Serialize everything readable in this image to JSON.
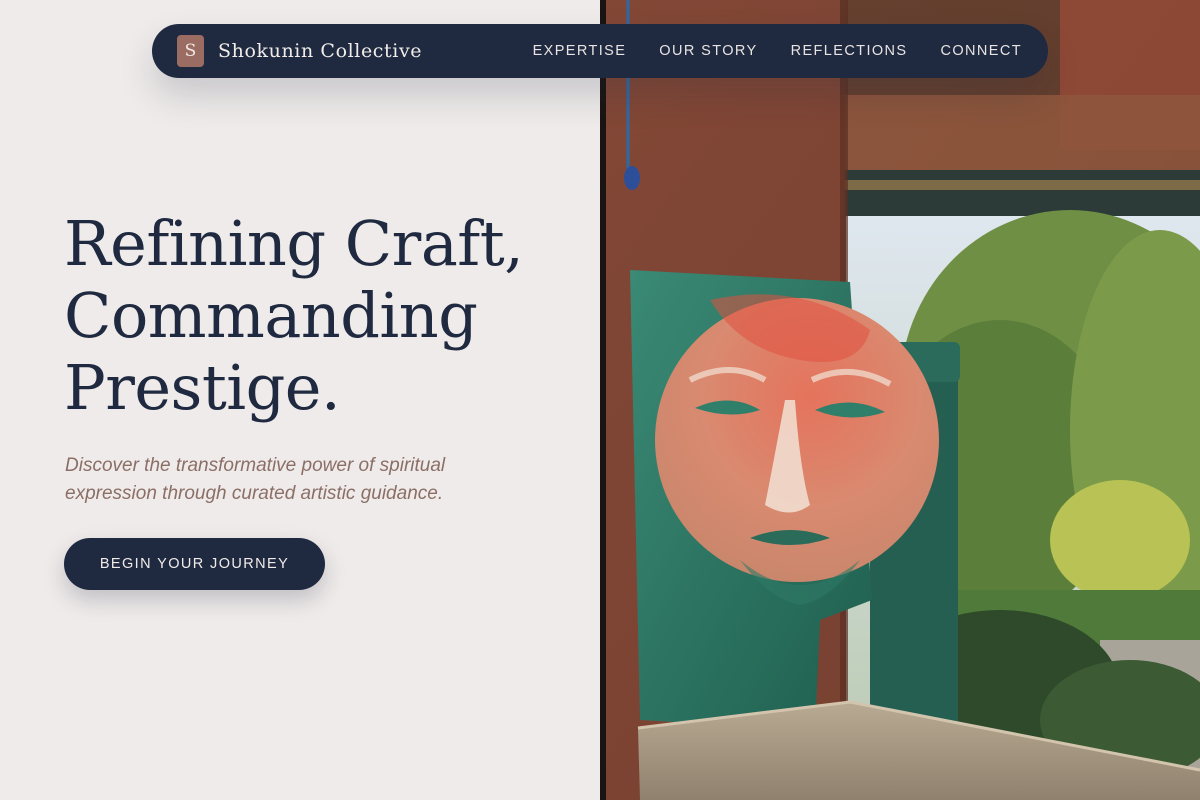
{
  "brand": {
    "mark": "S",
    "name": "Shokunin Collective",
    "mark_color": "#9b6c62"
  },
  "nav": {
    "items": [
      {
        "label": "EXPERTISE"
      },
      {
        "label": "OUR STORY"
      },
      {
        "label": "REFLECTIONS"
      },
      {
        "label": "CONNECT"
      }
    ]
  },
  "hero": {
    "title_lines": [
      "Refining Craft,",
      "Commanding",
      "Prestige."
    ],
    "subtitle": "Discover the transformative power of spiritual expression through curated artistic guidance.",
    "cta_label": "BEGIN YOUR JOURNEY"
  },
  "image": {
    "subject": "painted-face-panel-photo"
  },
  "colors": {
    "navy": "#1f2a40",
    "background": "#efebea",
    "accent_text": "#8b6f66",
    "rust": "#7a4334",
    "teal": "#2f7a66",
    "foliage": "#5f8a3a"
  }
}
